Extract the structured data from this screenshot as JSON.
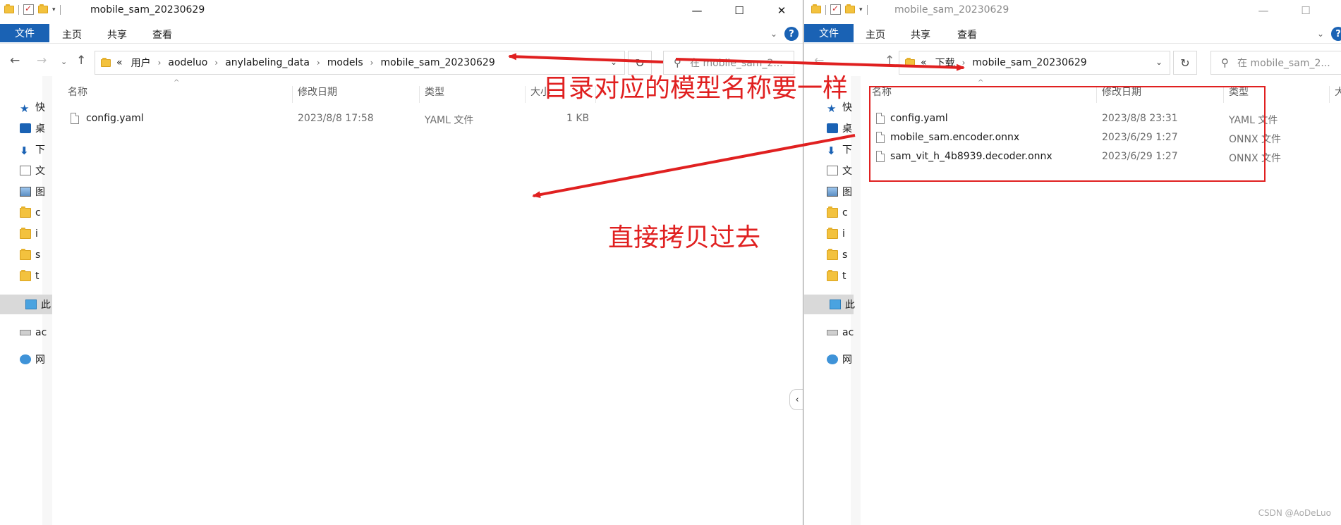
{
  "left_window": {
    "title": "mobile_sam_20230629",
    "ribbon": {
      "file": "文件",
      "home": "主页",
      "share": "共享",
      "view": "查看"
    },
    "breadcrumb": {
      "prefix": "«",
      "items": [
        "用户",
        "aodeluo",
        "anylabeling_data",
        "models",
        "mobile_sam_20230629"
      ]
    },
    "search_placeholder": "在 mobile_sam_2...",
    "columns": {
      "name": "名称",
      "modified": "修改日期",
      "type": "类型",
      "size": "大小"
    },
    "files": [
      {
        "name": "config.yaml",
        "modified": "2023/8/8 17:58",
        "type": "YAML 文件",
        "size": "1 KB"
      }
    ]
  },
  "right_window": {
    "title": "mobile_sam_20230629",
    "ribbon": {
      "file": "文件",
      "home": "主页",
      "share": "共享",
      "view": "查看"
    },
    "breadcrumb": {
      "prefix": "«",
      "items": [
        "下载",
        "mobile_sam_20230629"
      ]
    },
    "search_placeholder": "在 mobile_sam_2...",
    "columns": {
      "name": "名称",
      "modified": "修改日期",
      "type": "类型",
      "size": "大"
    },
    "files": [
      {
        "name": "config.yaml",
        "modified": "2023/8/8 23:31",
        "type": "YAML 文件"
      },
      {
        "name": "mobile_sam.encoder.onnx",
        "modified": "2023/6/29 1:27",
        "type": "ONNX 文件"
      },
      {
        "name": "sam_vit_h_4b8939.decoder.onnx",
        "modified": "2023/6/29 1:27",
        "type": "ONNX 文件"
      }
    ]
  },
  "sidebar_left": [
    {
      "label": "快",
      "icon": "star-icon"
    },
    {
      "label": "桌",
      "icon": "desktop-icon"
    },
    {
      "label": "下",
      "icon": "download-icon"
    },
    {
      "label": "文",
      "icon": "document-icon"
    },
    {
      "label": "图",
      "icon": "picture-icon"
    },
    {
      "label": "c",
      "icon": "folder-icon"
    },
    {
      "label": "i",
      "icon": "folder-icon"
    },
    {
      "label": "s",
      "icon": "folder-icon"
    },
    {
      "label": "t",
      "icon": "folder-icon"
    },
    {
      "label": "此",
      "icon": "this-pc-icon"
    },
    {
      "label": "ac",
      "icon": "drive-icon"
    },
    {
      "label": "网",
      "icon": "network-icon"
    }
  ],
  "sidebar_right": [
    {
      "label": "快",
      "icon": "star-icon"
    },
    {
      "label": "桌",
      "icon": "desktop-icon"
    },
    {
      "label": "下",
      "icon": "download-icon"
    },
    {
      "label": "文",
      "icon": "document-icon"
    },
    {
      "label": "图",
      "icon": "picture-icon"
    },
    {
      "label": "c",
      "icon": "folder-icon"
    },
    {
      "label": "i",
      "icon": "folder-icon"
    },
    {
      "label": "s",
      "icon": "folder-icon"
    },
    {
      "label": "t",
      "icon": "folder-icon"
    },
    {
      "label": "此",
      "icon": "this-pc-icon"
    },
    {
      "label": "ac",
      "icon": "drive-icon"
    },
    {
      "label": "网",
      "icon": "network-icon"
    }
  ],
  "annotations": {
    "same_name": "目录对应的模型名称要一样",
    "copy_over": "直接拷贝过去",
    "color": "#e02020"
  },
  "watermark": "CSDN @AoDeLuo"
}
